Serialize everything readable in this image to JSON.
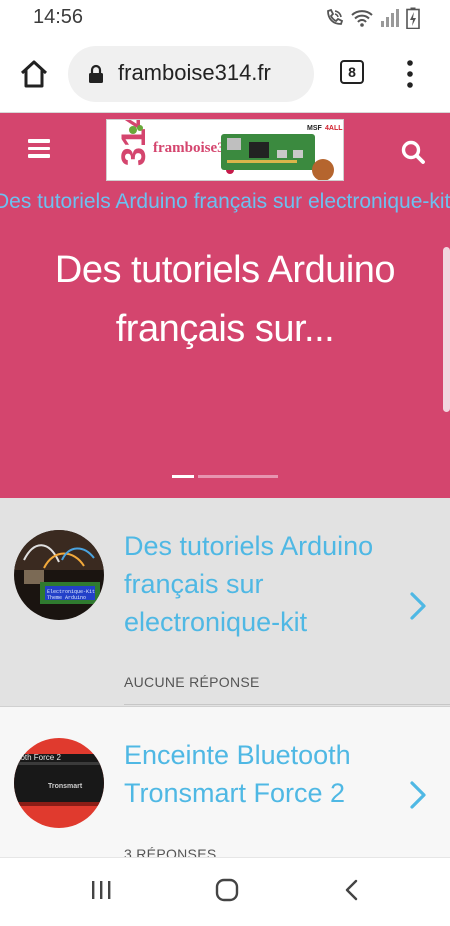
{
  "status_bar": {
    "time": "14:56",
    "icons": [
      "wifi-call-icon",
      "wifi-icon",
      "signal-icon",
      "battery-charging-icon"
    ]
  },
  "browser": {
    "url": "framboise314.fr",
    "tab_count": "8",
    "icons": [
      "home-icon",
      "lock-icon",
      "tabs-icon",
      "more-vert-icon"
    ]
  },
  "site_header": {
    "logo": {
      "name": "framboise314",
      "number": "314",
      "tagline": "le Raspberry Pi à la sauce française....",
      "partner": "MSF4ALL"
    },
    "colors": {
      "brand": "#d4456e",
      "accent": "#4fb8e4"
    }
  },
  "ticker": {
    "text": "Des tutoriels Arduino français sur electronique-kit"
  },
  "hero": {
    "title": "Des tutoriels Arduino français sur...",
    "slide_index": 1,
    "slide_count": 5
  },
  "posts": [
    {
      "title": "Des tutoriels Arduino français sur electronique-kit",
      "meta": "AUCUNE RÉPONSE",
      "thumb_text": "Electronique-Kit\nTheme Arduino"
    },
    {
      "title": "Enceinte Bluetooth Tronsmart Force 2",
      "meta": "3 RÉPONSES",
      "thumb_text": "ooth Force 2",
      "thumb_brand": "Tronsmart"
    }
  ],
  "nav_bar": {
    "icons": [
      "recent-apps-icon",
      "home-circle-icon",
      "back-icon"
    ]
  }
}
